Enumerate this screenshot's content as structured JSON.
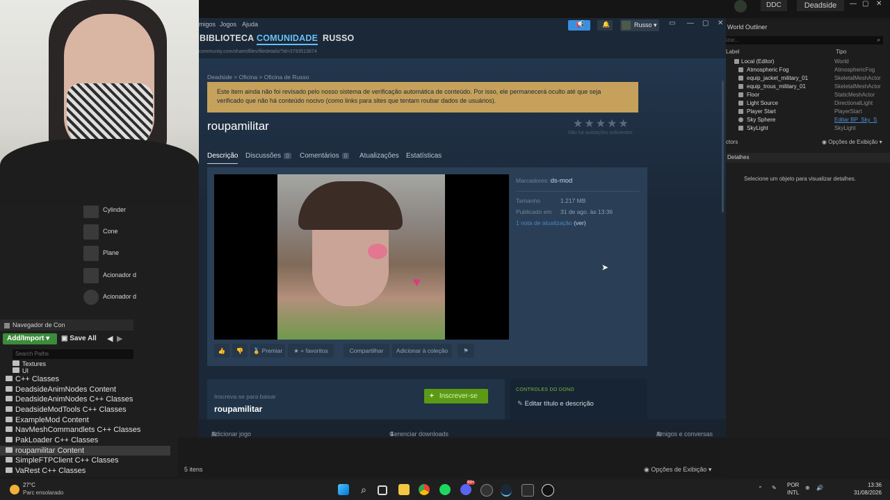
{
  "unreal": {
    "ddc": "DDC",
    "project": "Deadside",
    "place_items": [
      "Cylinder",
      "Cone",
      "Plane",
      "Acionador d",
      "Acionador d"
    ],
    "content_browser": {
      "tab": "Navegador de Con",
      "add_import": "Add/Import ▾",
      "save_all": "Save All",
      "search_placeholder": "Search Paths",
      "tree": [
        "Textures",
        "UI",
        "C++ Classes",
        "DeadsideAnimNodes Content",
        "DeadsideAnimNodes C++ Classes",
        "DeadsideModTools C++ Classes",
        "ExampleMod Content",
        "NavMeshCommandlets C++ Classes",
        "PakLoader C++ Classes",
        "roupamilitar Content",
        "SimpleFTPClient C++ Classes",
        "VaRest C++ Classes"
      ],
      "items_count": "5 itens",
      "view_options": "Opções de Exibição ▾"
    },
    "outliner": {
      "tab": "World Outliner",
      "search_placeholder": "izar...",
      "col_label": "Label",
      "col_type": "Tipo",
      "rows": [
        {
          "name": "Local (Editor)",
          "type": "World"
        },
        {
          "name": "Atmospheric Fog",
          "type": "AtmosphericFog"
        },
        {
          "name": "equip_jacket_military_01",
          "type": "SkeletalMeshActor"
        },
        {
          "name": "equip_trous_military_01",
          "type": "SkeletalMeshActor"
        },
        {
          "name": "Floor",
          "type": "StaticMeshActor"
        },
        {
          "name": "Light Source",
          "type": "DirectionalLight"
        },
        {
          "name": "Player Start",
          "type": "PlayerStart"
        },
        {
          "name": "Sky Sphere",
          "type": "Editar BP_Sky_S"
        },
        {
          "name": "SkyLight",
          "type": "SkyLight"
        }
      ],
      "actors": "ctors",
      "view_options": "Opções de Exibição ▾",
      "details_tab": "Detalhes",
      "details_hint": "Selecione um objeto para visualizar detalhes."
    }
  },
  "steam": {
    "menu": [
      "migos",
      "Jogos",
      "Ajuda"
    ],
    "nav": {
      "library": "BIBLIOTECA",
      "community": "COMUNIDADE",
      "user": "RUSSO"
    },
    "url": "community.com/sharedfiles/filedetails/?id=3793513674",
    "username": "Russo ▾",
    "breadcrumb": "Deadside  >  Oficina  >  Oficina de Russo",
    "notice": "Este item ainda não foi revisado pelo nosso sistema de verificação automática de conteúdo. Por isso, ele permanecerá oculto até que seja verificado que não há conteúdo nocivo (como links para sites que tentam roubar dados de usuários).",
    "title": "roupamilitar",
    "stars": "★★★★★",
    "stars_note": "Não há avaliações suficientes",
    "tabs": [
      {
        "label": "Descrição"
      },
      {
        "label": "Discussões",
        "count": "0"
      },
      {
        "label": "Comentários",
        "count": "0"
      },
      {
        "label": "Atualizações"
      },
      {
        "label": "Estatísticas"
      }
    ],
    "meta": {
      "tags_label": "Marcadores:",
      "tags_value": "ds-mod",
      "size_label": "Tamanho",
      "size_value": "1.217 MB",
      "posted_label": "Publicado em",
      "posted_value": "31 de ago. às 13:36",
      "update_note": "1 nota de atualização",
      "update_view": "(ver)"
    },
    "actions": {
      "award": "Premiar",
      "favorite": "+ favoritos",
      "share": "Compartilhar",
      "collection": "Adicionar à coleção"
    },
    "subscribe": {
      "small": "Inscreva-se para baixar",
      "title": "roupamilitar",
      "button": "Inscrever-se"
    },
    "owner": {
      "heading": "CONTROLES DO DONO",
      "edit": "Editar título e descrição"
    },
    "footer": {
      "add_game": "Adicionar jogo",
      "downloads": "Gerenciar downloads",
      "friends": "Amigos e conversas"
    }
  },
  "taskbar": {
    "temp": "27°C",
    "weather": "Parc ensolarado",
    "lang1": "POR",
    "lang2": "INTL",
    "time": "13:36",
    "date": "31/08/2026",
    "chat_badge": "99+"
  },
  "colors": {
    "steam_accent": "#66c0f4",
    "notice": "#c6a15b",
    "subscribe": "#5c9a16",
    "ue_green": "#3b8c3b"
  }
}
